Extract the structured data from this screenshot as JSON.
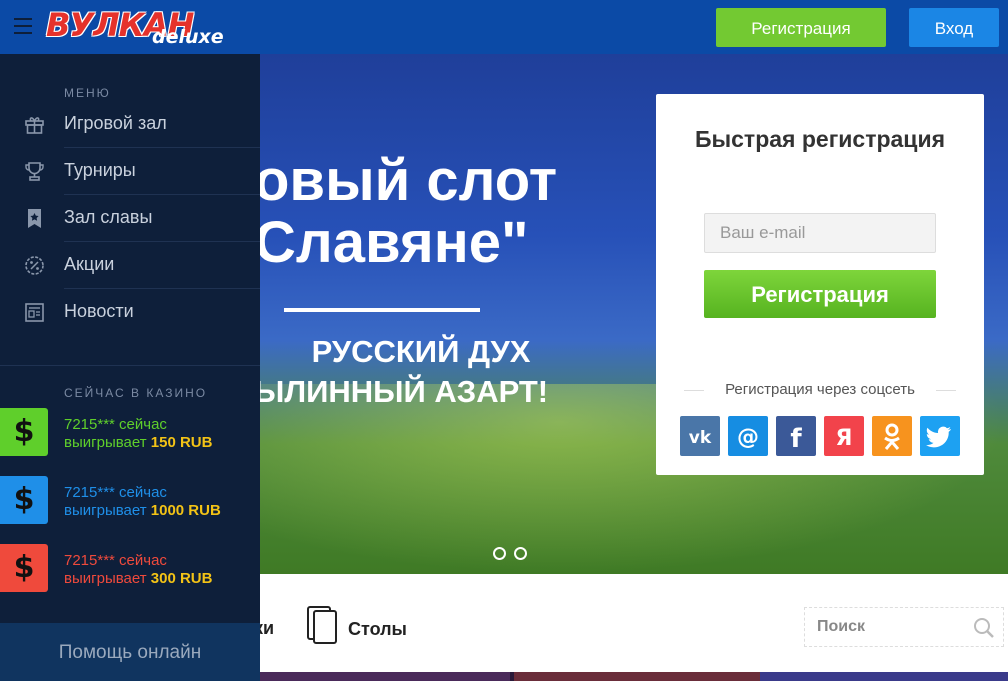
{
  "header": {
    "logo_main": "ВУЛКАН",
    "logo_sub": "deluxe",
    "register_label": "Регистрация",
    "login_label": "Вход"
  },
  "banner": {
    "title_line1": "овый слот",
    "title_line2": "Славяне\"",
    "sub_line1": "РУССКИЙ ДУХ",
    "sub_line2": "ЫЛИННЫЙ АЗАРТ!",
    "slides": 2
  },
  "quick_reg": {
    "title": "Быстрая регистрация",
    "email_placeholder": "Ваш e-mail",
    "register_label": "Регистрация",
    "social_label": "Регистрация через соцсеть",
    "socials": [
      {
        "name": "vk",
        "glyph": "vk",
        "color": "#4a76a8"
      },
      {
        "name": "mail",
        "glyph": "@",
        "color": "#168de2"
      },
      {
        "name": "facebook",
        "glyph": "f",
        "color": "#3b5998"
      },
      {
        "name": "yandex",
        "glyph": "Я",
        "color": "#f2434b"
      },
      {
        "name": "odnoklassniki",
        "glyph": "ok",
        "color": "#f7931e"
      },
      {
        "name": "twitter",
        "glyph": "tw",
        "color": "#1da1f2"
      }
    ]
  },
  "categories": {
    "partial_label": "ки",
    "tables_label": "Столы",
    "search_placeholder": "Поиск"
  },
  "sidebar": {
    "menu_title": "МЕНЮ",
    "items": [
      {
        "label": "Игровой зал",
        "icon": "gift-icon"
      },
      {
        "label": "Турниры",
        "icon": "trophy-icon"
      },
      {
        "label": "Зал славы",
        "icon": "bookmark-star-icon"
      },
      {
        "label": "Акции",
        "icon": "percent-badge-icon"
      },
      {
        "label": "Новости",
        "icon": "newspaper-icon"
      }
    ],
    "casino_title": "СЕЙЧАС В КАЗИНО",
    "winners": [
      {
        "user": "7215*** сейчас",
        "wins": "выигрывает",
        "amount": "150 RUB",
        "color": "#5fcf2b"
      },
      {
        "user": "7215*** сейчас",
        "wins": "выигрывает",
        "amount": "1000 RUB",
        "color": "#1f8fe8"
      },
      {
        "user": "7215*** сейчас",
        "wins": "выигрывает",
        "amount": "300 RUB",
        "color": "#ef4a3c"
      }
    ],
    "help_label": "Помощь онлайн"
  }
}
